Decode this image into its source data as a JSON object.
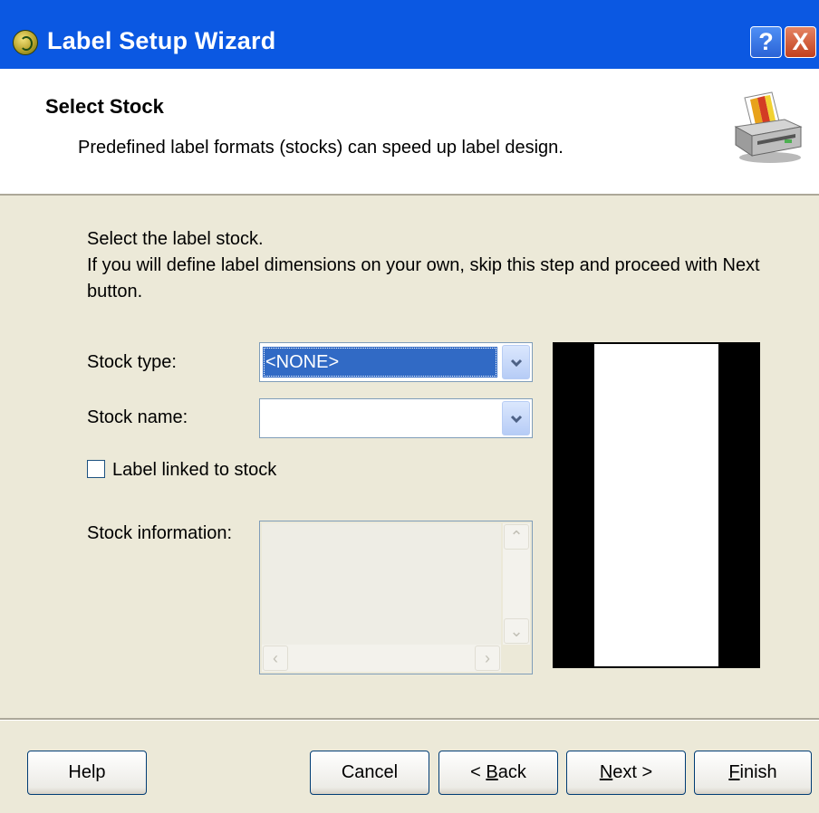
{
  "window": {
    "title": "Label Setup Wizard",
    "help_button": "?",
    "close_button": "X"
  },
  "header": {
    "title": "Select Stock",
    "subtitle": "Predefined label formats (stocks) can speed up label design."
  },
  "body": {
    "intro_line1": "Select the label stock.",
    "intro_line2": "If you will define label dimensions on your own, skip this step and proceed with Next button.",
    "stock_type_label": "Stock type:",
    "stock_type_value": "<NONE>",
    "stock_name_label": "Stock name:",
    "stock_name_value": "",
    "linked_label": "Label linked to stock",
    "linked_checked": false,
    "stock_info_label": "Stock information:"
  },
  "buttons": {
    "help": "Help",
    "cancel": "Cancel",
    "back_prefix": "< ",
    "back_key": "B",
    "back_rest": "ack",
    "next_key": "N",
    "next_rest": "ext >",
    "finish_key": "F",
    "finish_rest": "inish"
  },
  "colors": {
    "titlebar": "#0b58e2",
    "dialog_bg": "#ECE9D8",
    "selection": "#316AC5",
    "preview_frame": "#000000"
  }
}
